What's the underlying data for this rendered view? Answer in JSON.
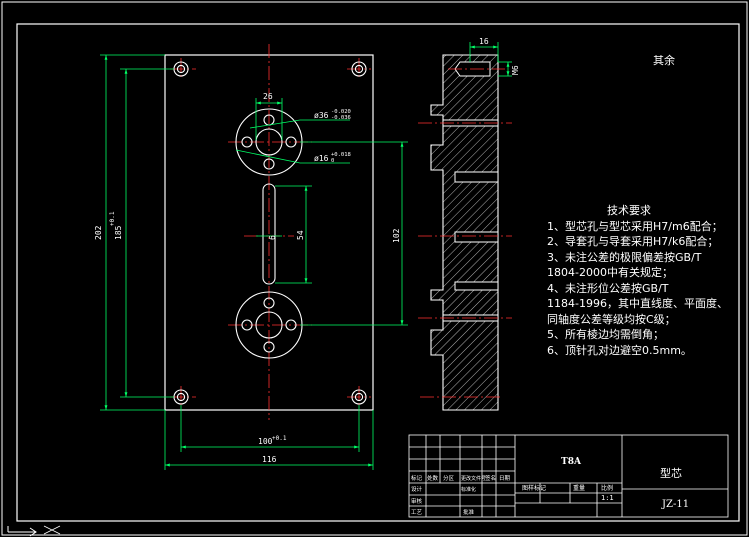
{
  "drawing": {
    "remainder_note": "其余",
    "technical_requirements": {
      "title": "技术要求",
      "lines": [
        "1、型芯孔与型芯采用H7/m6配合；",
        "2、导套孔与导套采用H7/k6配合；",
        "3、未注公差的极限偏差按GB/T",
        "1804-2000中有关规定；",
        "4、未注形位公差按GB/T",
        "1184-1996，其中直线度、平面度、",
        "同轴度公差等级均按C级；",
        "5、所有棱边均需倒角；",
        "6、顶针孔对边避空0.5mm。"
      ]
    },
    "dimensions": {
      "top_width": "26",
      "dia_36": "ø36",
      "dia_36_tol_up": "-0.020",
      "dia_36_tol_low": "-0.036",
      "dia_16": "ø16",
      "dia_16_tol_up": "+0.018",
      "dia_16_tol_low": "0",
      "height_202": "202",
      "height_185": "185",
      "height_185_tol": "+0.1",
      "height_185_tol_low": "0",
      "width_100": "100",
      "width_100_tol": "+0.1",
      "width_100_tol_low": "0",
      "width_116": "116",
      "slot_54": "54",
      "slot_6": "6",
      "height_102": "102",
      "side_16": "16",
      "side_m6": "M6"
    },
    "title_block": {
      "material": "T8A",
      "part_name": "型芯",
      "drawing_no": "JZ-11",
      "scale_label": "比例",
      "scale": "1:1",
      "weight_label": "重量",
      "stage_label": "图样标记",
      "revision_cols": [
        "标记",
        "处数",
        "分区",
        "更改文件号",
        "签名",
        "日期"
      ],
      "design_label": "设计",
      "standardize_label": "标准化",
      "check_label": "审核",
      "process_label": "工艺",
      "approve_label": "批准"
    }
  },
  "colors": {
    "background": "#000000",
    "outline": "#ffffff",
    "centerline": "#ff3030",
    "dimension": "#00ff66",
    "hatch": "#ffffff"
  }
}
